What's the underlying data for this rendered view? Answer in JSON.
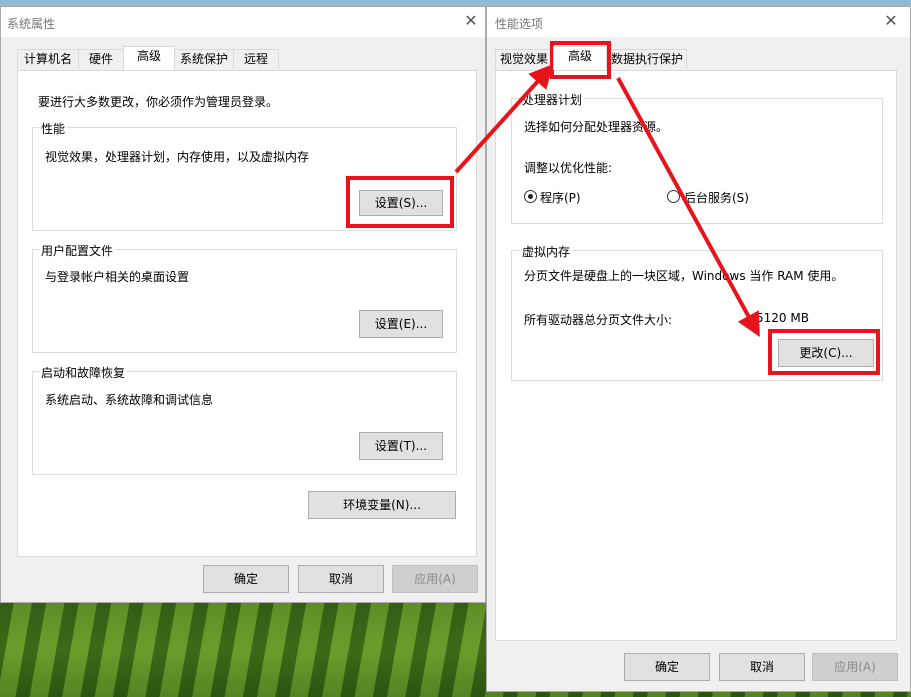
{
  "sys": {
    "title": "系统属性",
    "close_glyph": "✕",
    "tabs": [
      "计算机名",
      "硬件",
      "高级",
      "系统保护",
      "远程"
    ],
    "admin_note": "要进行大多数更改，你必须作为管理员登录。",
    "perf": {
      "title": "性能",
      "desc": "视觉效果，处理器计划，内存使用，以及虚拟内存",
      "button": "设置(S)..."
    },
    "profile": {
      "title": "用户配置文件",
      "desc": "与登录帐户相关的桌面设置",
      "button": "设置(E)..."
    },
    "startup": {
      "title": "启动和故障恢复",
      "desc": "系统启动、系统故障和调试信息",
      "button": "设置(T)..."
    },
    "env_button": "环境变量(N)...",
    "ok": "确定",
    "cancel": "取消",
    "apply": "应用(A)"
  },
  "perf": {
    "title": "性能选项",
    "close_glyph": "✕",
    "tabs": [
      "视觉效果",
      "高级",
      "数据执行保护"
    ],
    "cpu": {
      "title": "处理器计划",
      "desc": "选择如何分配处理器资源。",
      "label": "调整以优化性能:",
      "opt_programs": "程序(P)",
      "opt_services": "后台服务(S)"
    },
    "vm": {
      "title": "虚拟内存",
      "desc": "分页文件是硬盘上的一块区域，Windows 当作 RAM 使用。",
      "total_label": "所有驱动器总分页文件大小:",
      "total_value": "5120 MB",
      "change_button": "更改(C)..."
    },
    "ok": "确定",
    "cancel": "取消",
    "apply": "应用(A)"
  },
  "highlight_color": "#e8141c"
}
